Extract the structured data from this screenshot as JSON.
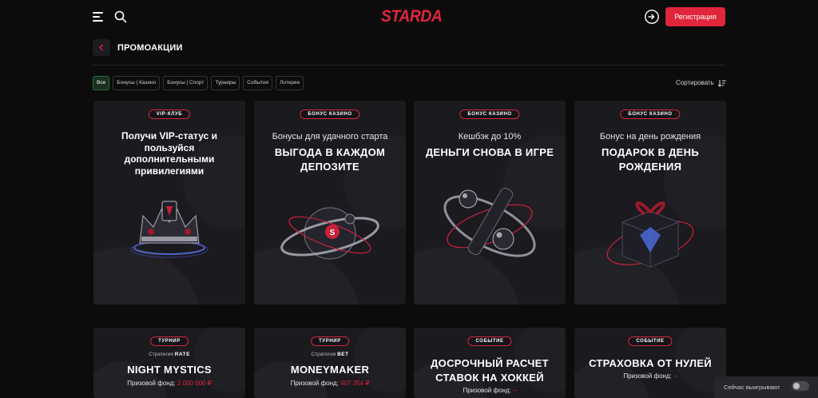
{
  "header": {
    "logo": "STARDA",
    "register_label": "Регистрация"
  },
  "page": {
    "title": "ПРОМОАКЦИИ"
  },
  "filters": {
    "items": [
      "Все",
      "Бонусы | Казино",
      "Бонусы | Спорт",
      "Турниры",
      "События",
      "Лотереи"
    ],
    "active_index": 0,
    "sort_label": "Сортировать"
  },
  "cards_row1": [
    {
      "badge": "VIP-КЛУБ",
      "text": "Получи VIP-статус и пользуйся дополнительными привилегиями",
      "art": "crown"
    },
    {
      "badge": "БОНУС КАЗИНО",
      "subtitle": "Бонусы для удачного старта",
      "headline": "ВЫГОДА В КАЖДОМ ДЕПОЗИТЕ",
      "art": "planet"
    },
    {
      "badge": "БОНУС КАЗИНО",
      "subtitle": "Кешбэк до 10%",
      "headline": "ДЕНЬГИ СНОВА В ИГРЕ",
      "art": "cashback"
    },
    {
      "badge": "БОНУС КАЗИНО",
      "subtitle": "Бонус на день рождения",
      "headline": "ПОДАРОК В ДЕНЬ РОЖДЕНИЯ",
      "art": "gift"
    }
  ],
  "cards_row2": [
    {
      "badge": "ТУРНИР",
      "strategy_prefix": "Стратегия",
      "strategy": "RATE",
      "headline": "NIGHT MYSTICS",
      "prize_label": "Призовой фонд:",
      "prize_value": "2 000 000 ₽"
    },
    {
      "badge": "ТУРНИР",
      "strategy_prefix": "Стратегия",
      "strategy": "BET",
      "headline": "MONEYMAKER",
      "prize_label": "Призовой фонд:",
      "prize_value": "407 354 ₽"
    },
    {
      "badge": "СОБЫТИЕ",
      "headline": "ДОСРОЧНЫЙ РАСЧЕТ СТАВОК НА ХОККЕЙ",
      "prize_label": "Призовой фонд:",
      "prize_value": "–"
    },
    {
      "badge": "СОБЫТИЕ",
      "headline": "СТРАХОВКА ОТ НУЛЕЙ",
      "prize_label": "Призовой фонд:",
      "prize_value": "–"
    }
  ],
  "live_widget": {
    "label": "Сейчас выигрывают",
    "toggle_on": false
  },
  "colors": {
    "accent": "#e0263b",
    "background": "#0c0c0d",
    "card": "#1a1a1f",
    "active_chip": "#17301f"
  },
  "icons": [
    "menu-icon",
    "search-icon",
    "login-icon",
    "chevron-left-icon",
    "sort-icon"
  ]
}
